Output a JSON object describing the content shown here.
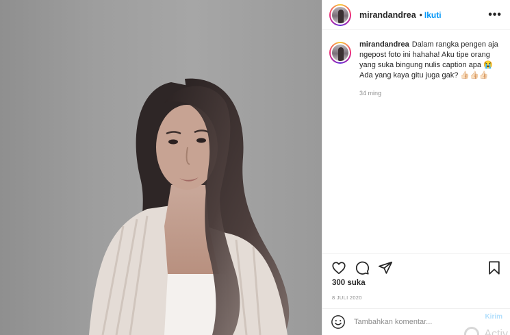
{
  "post": {
    "username": "mirandandrea",
    "dot": "•",
    "follow_label": "Ikuti",
    "more_label": "•••",
    "caption": "Dalam rangka pengen aja ngepost foto ini hahaha! Aku tipe orang yang suka bingung nulis caption apa 😭 Ada yang kaya gitu juga gak? 👍🏻👍🏻👍🏻",
    "caption_time": "34 ming",
    "likes": "300 suka",
    "date": "8 JULI 2020"
  },
  "comment": {
    "placeholder": "Tambahkan komentar...",
    "send_label": "Kirim"
  },
  "watermark": "Activ",
  "icons": {
    "like": "heart-icon",
    "comment": "comment-icon",
    "share": "paper-plane-icon",
    "save": "bookmark-icon",
    "emoji": "emoji-icon",
    "more": "more-options-icon"
  },
  "colors": {
    "accent": "#0095f6",
    "send_disabled": "#b2dffc",
    "muted": "#8e8e8e",
    "text": "#262626"
  }
}
